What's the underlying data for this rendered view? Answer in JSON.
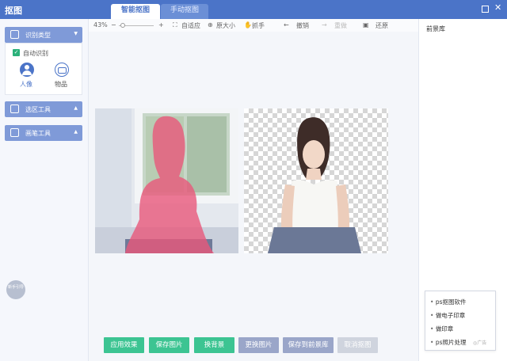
{
  "app": {
    "title": "抠图"
  },
  "tabs": [
    {
      "label": "智能抠图",
      "active": true
    },
    {
      "label": "手动抠图",
      "active": false
    }
  ],
  "sidebar": {
    "recognition_type": "识别类型",
    "auto_recognize": "自动识别",
    "options": [
      {
        "label": "人像",
        "selected": true
      },
      {
        "label": "物品",
        "selected": false
      }
    ],
    "selection_tool": "选区工具",
    "brush_tool": "画笔工具",
    "guide": "新手引导"
  },
  "toolbar": {
    "zoom": "43%",
    "zoom_level": 0.12,
    "fit": "自适应",
    "original_size": "原大小",
    "hand": "抓手",
    "undo": "撤销",
    "redo": "重做",
    "restore": "还原"
  },
  "actions": {
    "apply": "应用效果",
    "save_image": "保存图片",
    "change_bg": "换背景",
    "replace_image": "更换图片",
    "save_to_fg": "保存到前景库",
    "cancel_cutout": "取消抠图"
  },
  "right_panel": {
    "title": "前景库"
  },
  "suggestions": {
    "items": [
      "ps抠图软件",
      "做电子印章",
      "做印章",
      "ps照片处理"
    ],
    "watermark": "◎广告"
  },
  "colors": {
    "title_bar": "#4b74c8",
    "panel_header": "#7f9ad8",
    "primary_button": "#3cc492",
    "secondary_button": "#9aa6c9",
    "disabled_button": "#cfd4de",
    "selection_overlay": "#e9587a"
  },
  "icons": {
    "window_maximize": "square-icon",
    "window_close": "close-icon",
    "person": "person-icon",
    "object": "box-icon"
  }
}
